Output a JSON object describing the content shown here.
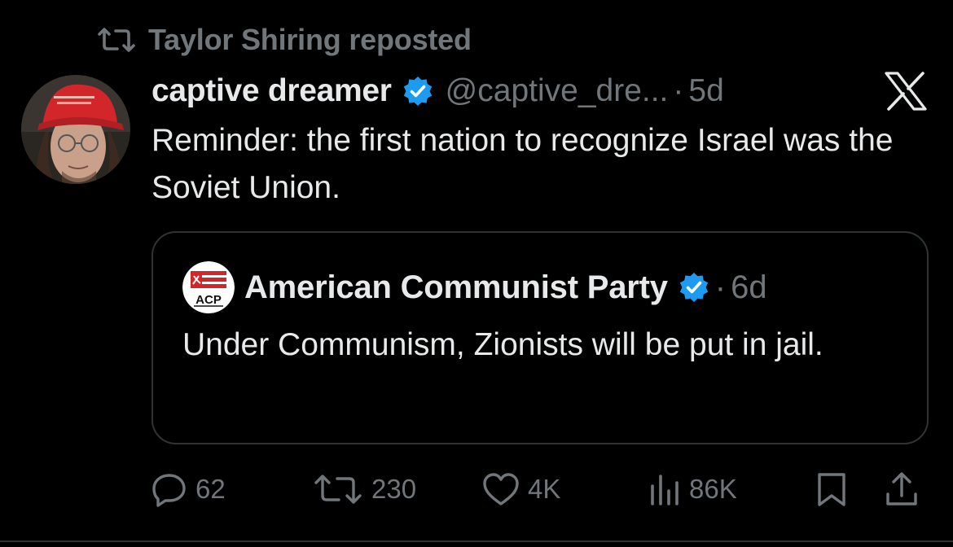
{
  "repost": {
    "icon": "repost-icon",
    "label": "Taylor Shiring reposted"
  },
  "tweet": {
    "display_name": "captive dreamer",
    "verified_icon": "verified-badge-icon",
    "handle": "@captive_dre...",
    "separator": "·",
    "time": "5d",
    "text": "Reminder: the first nation to recognize Israel was the Soviet Union."
  },
  "brand": {
    "logo": "x-logo-icon"
  },
  "quote": {
    "display_name": "American Communist Party",
    "avatar_text": "ACP",
    "verified_icon": "verified-badge-icon",
    "separator": "·",
    "time": "6d",
    "text": "Under Communism, Zionists will be put in jail."
  },
  "actions": {
    "reply_count": "62",
    "repost_count": "230",
    "like_count": "4K",
    "views_count": "86K"
  },
  "colors": {
    "background": "#000000",
    "text": "#e7e9ea",
    "muted": "#71767b",
    "verified": "#1d9bf0",
    "border": "#2f3336"
  }
}
